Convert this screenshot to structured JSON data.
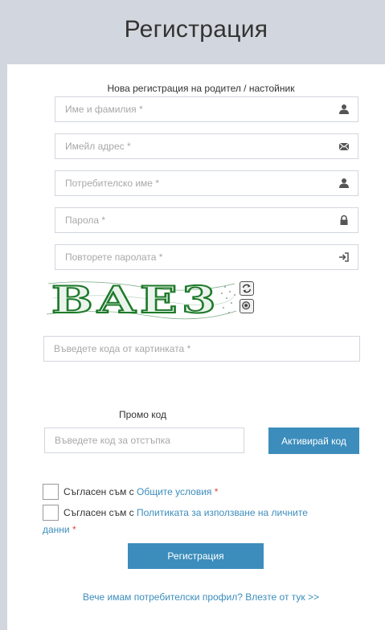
{
  "header": {
    "title": "Регистрация"
  },
  "form": {
    "subtitle": "Нова регистрация на родител / настойник",
    "fields": [
      {
        "placeholder": "Име и фамилия *",
        "icon": "user-icon"
      },
      {
        "placeholder": "Имейл адрес *",
        "icon": "envelope-icon"
      },
      {
        "placeholder": "Потребителско име *",
        "icon": "user-icon"
      },
      {
        "placeholder": "Парола *",
        "icon": "lock-icon"
      },
      {
        "placeholder": "Повторете паролата *",
        "icon": "log-in-icon"
      }
    ],
    "captcha": {
      "text": "BAE3",
      "input_placeholder": "Въведете кода от картинката *"
    }
  },
  "promo": {
    "label": "Промо код",
    "placeholder": "Въведете код за отстъпка",
    "button": "Активирай код"
  },
  "agreements": {
    "terms_prefix": "Съгласен съм с ",
    "terms_link": "Общите условия",
    "privacy_prefix": "Съгласен съм с ",
    "privacy_link": "Политиката за използване на личните",
    "privacy_link_2": "данни",
    "required_mark": "*"
  },
  "actions": {
    "register": "Регистрация",
    "login_link": "Вече имам потребителски профил? Влезте от тук >>"
  },
  "colors": {
    "header_bg": "#d2d6de",
    "primary": "#3c8dbc",
    "required": "#dd4b39",
    "captcha": "#1e7a2a"
  }
}
